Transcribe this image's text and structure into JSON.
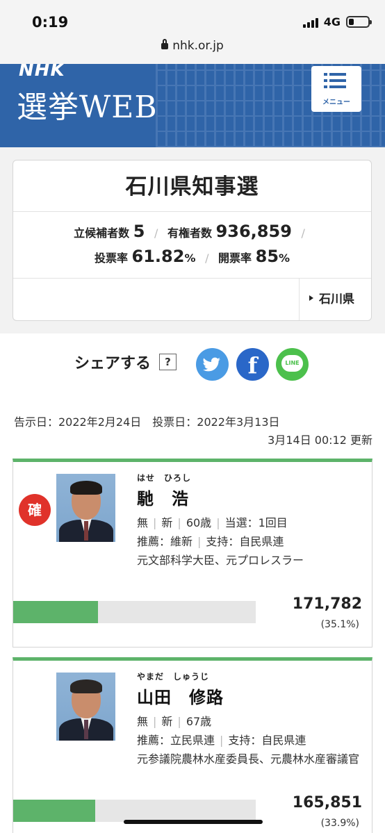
{
  "status_bar": {
    "time": "0:19",
    "network": "4G"
  },
  "browser": {
    "url": "nhk.or.jp"
  },
  "header": {
    "logo": "NHK",
    "title": "選挙WEB",
    "menu_label": "メニュー"
  },
  "election": {
    "title": "石川県知事選",
    "candidates_label": "立候補者数",
    "candidates_value": "5",
    "voters_label": "有権者数",
    "voters_value": "936,859",
    "turnout_label": "投票率",
    "turnout_value": "61.82",
    "turnout_unit": "%",
    "counted_label": "開票率",
    "counted_value": "85",
    "counted_unit": "%",
    "prefecture_link": "石川県"
  },
  "share": {
    "label": "シェアする",
    "help": "?",
    "twitter_icon": "twitter-icon",
    "facebook_icon": "facebook-icon",
    "line_icon": "line-icon",
    "line_text": "LINE",
    "facebook_glyph": "f"
  },
  "dates": {
    "announce": "告示日：2022年2月24日　投票日：2022年3月13日",
    "updated": "3月14日 00:12 更新"
  },
  "candidates": [
    {
      "elected_badge": "確",
      "kana": "はせ　ひろし",
      "name": "馳　浩",
      "party": "無",
      "status": "新",
      "age": "60歳",
      "term": "当選：1回目",
      "endorse": "推薦：維新",
      "support": "支持：自民県連",
      "career": "元文部科学大臣、元プロレスラー",
      "votes": "171,782",
      "pct_text": "(35.1%)",
      "share": 0.351
    },
    {
      "kana": "やまだ　しゅうじ",
      "name": "山田　修路",
      "party": "無",
      "status": "新",
      "age": "67歳",
      "endorse": "推薦：立民県連",
      "support": "支持：自民県連",
      "career": "元参議院農林水産委員長、元農林水産審議官",
      "votes": "165,851",
      "pct_text": "(33.9%)",
      "share": 0.339
    }
  ],
  "colors": {
    "header_blue": "#2f64a8",
    "accent_green": "#5db36a",
    "elected_red": "#e0322a"
  }
}
